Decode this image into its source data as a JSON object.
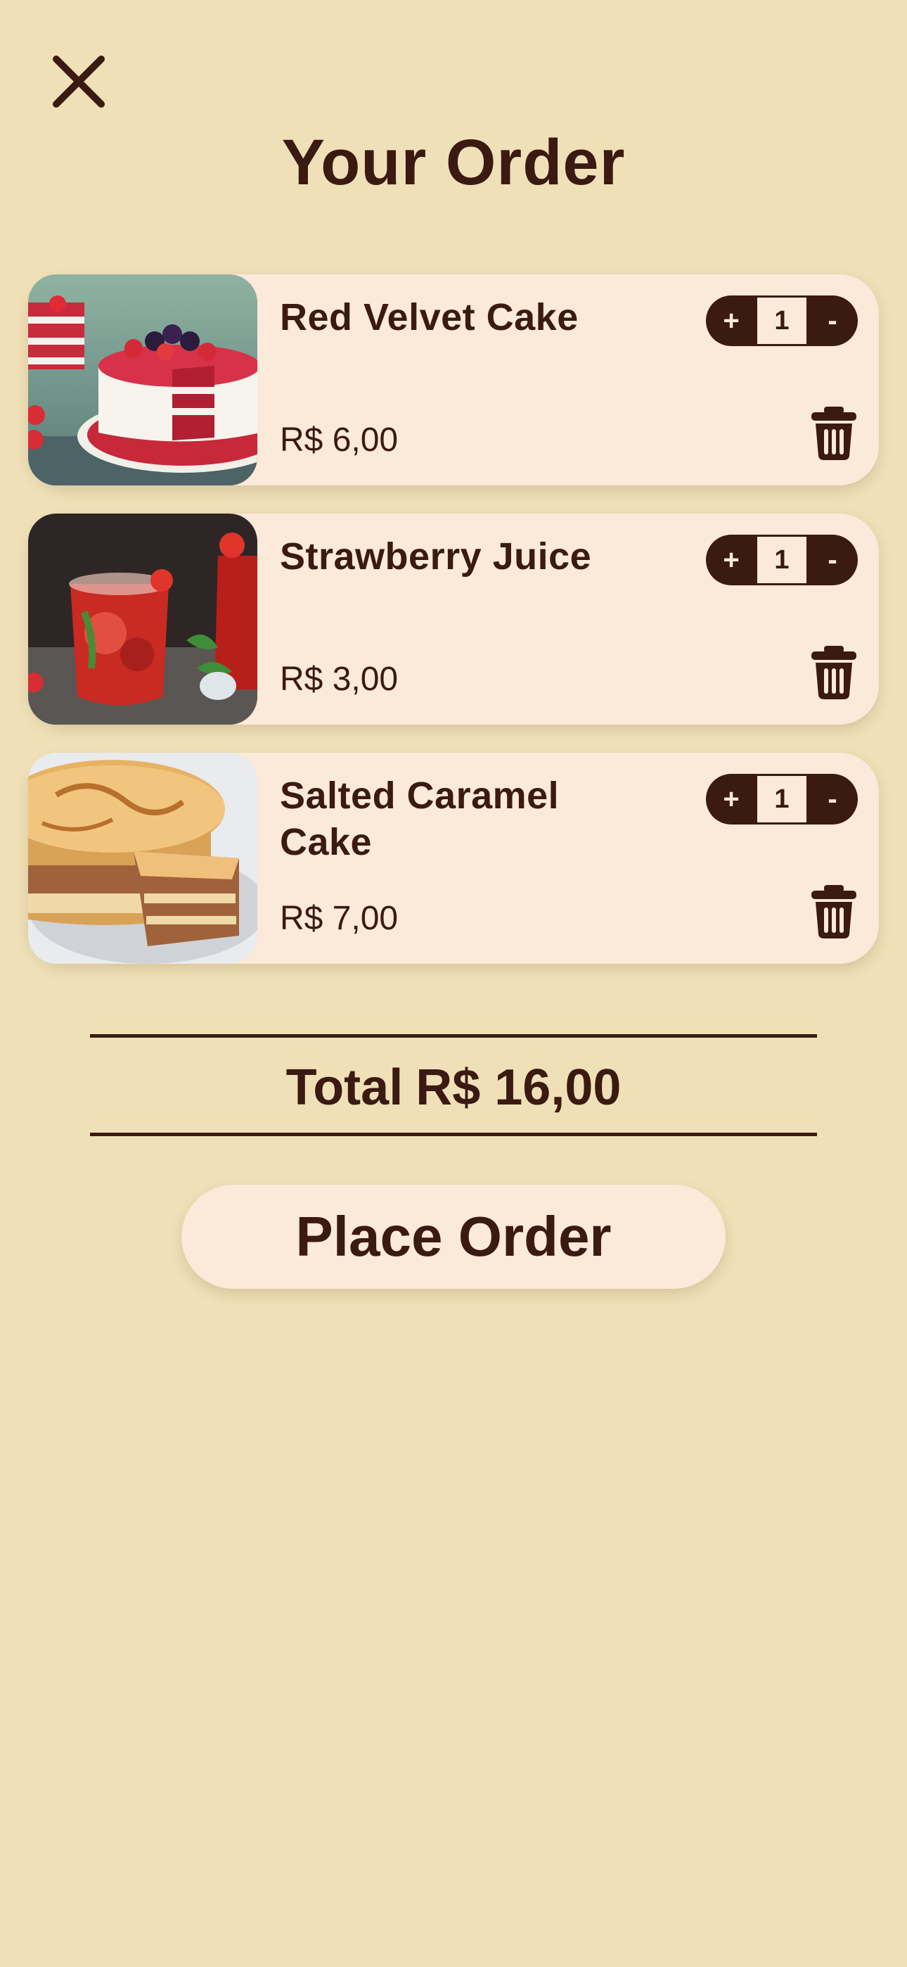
{
  "header": {
    "close_icon": "close-icon",
    "title": "Your Order"
  },
  "order": {
    "items": [
      {
        "name": "Red Velvet Cake",
        "price": "R$ 6,00",
        "quantity": "1",
        "plus_label": "+",
        "minus_label": "-",
        "image": "red-velvet-cake-photo",
        "delete_icon": "trash-icon"
      },
      {
        "name": "Strawberry Juice",
        "price": "R$ 3,00",
        "quantity": "1",
        "plus_label": "+",
        "minus_label": "-",
        "image": "strawberry-juice-photo",
        "delete_icon": "trash-icon"
      },
      {
        "name": "Salted Caramel Cake",
        "price": "R$ 7,00",
        "quantity": "1",
        "plus_label": "+",
        "minus_label": "-",
        "image": "salted-caramel-cake-photo",
        "delete_icon": "trash-icon"
      }
    ]
  },
  "summary": {
    "total_label": "Total",
    "total_value": "R$ 16,00"
  },
  "actions": {
    "place_order_label": "Place Order"
  },
  "colors": {
    "background": "#efe0b8",
    "card": "#fbe9d9",
    "text_dark": "#3b1a12"
  }
}
